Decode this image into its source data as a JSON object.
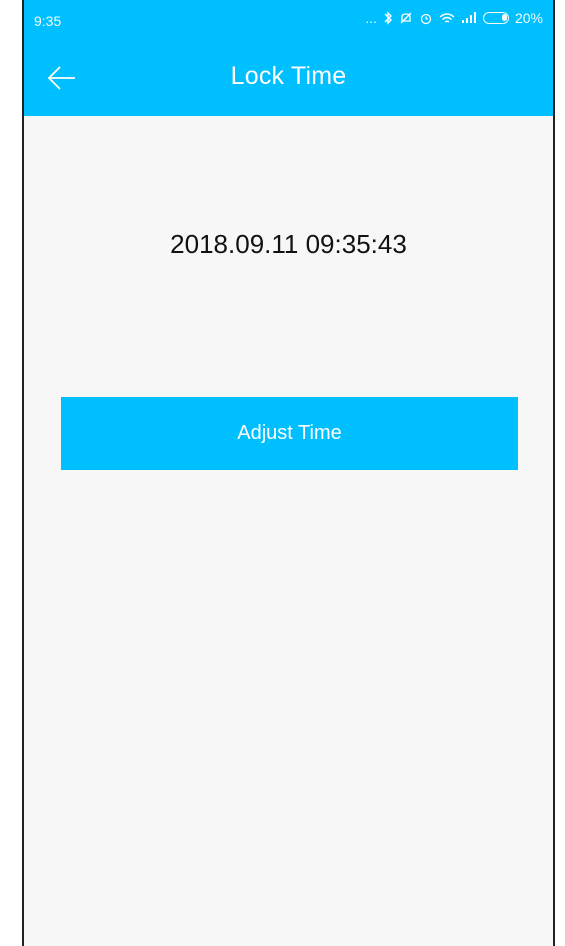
{
  "status_bar": {
    "time": "9:35",
    "dots": "...",
    "battery_percent": "20%"
  },
  "app_bar": {
    "title": "Lock Time",
    "back_icon": "arrow-left-icon"
  },
  "main": {
    "lock_datetime": "2018.09.11 09:35:43",
    "adjust_button_label": "Adjust Time"
  },
  "colors": {
    "accent": "#00bfff",
    "background": "#f7f7f7",
    "text": "#111111"
  }
}
